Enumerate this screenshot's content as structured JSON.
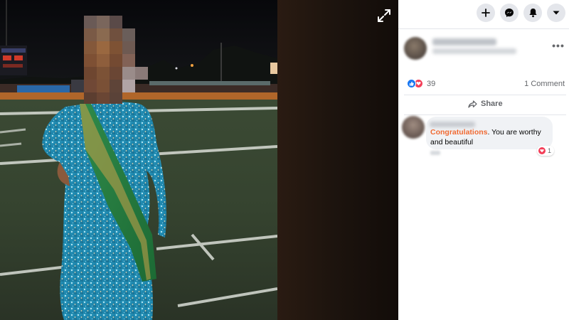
{
  "viewer": {
    "photo_description": "",
    "expand_icon": "expand-arrows-icon"
  },
  "panel": {
    "top_buttons": [
      {
        "icon": "plus-icon"
      },
      {
        "icon": "messenger-icon"
      },
      {
        "icon": "bell-icon"
      },
      {
        "icon": "caret-down-icon"
      }
    ],
    "author": {
      "name": "",
      "meta": ""
    },
    "reactions": {
      "count": "39",
      "icons": [
        "like-icon",
        "love-icon"
      ]
    },
    "comments_label": "1 Comment",
    "share_label": "Share",
    "comment": {
      "author": "",
      "highlight": "Congratulations",
      "rest": ". You are worthy and beautiful",
      "reaction_count": "1",
      "time": ""
    },
    "colors": {
      "accent": "#1877f2",
      "love": "#f33e58",
      "highlight": "#f06a33"
    }
  }
}
